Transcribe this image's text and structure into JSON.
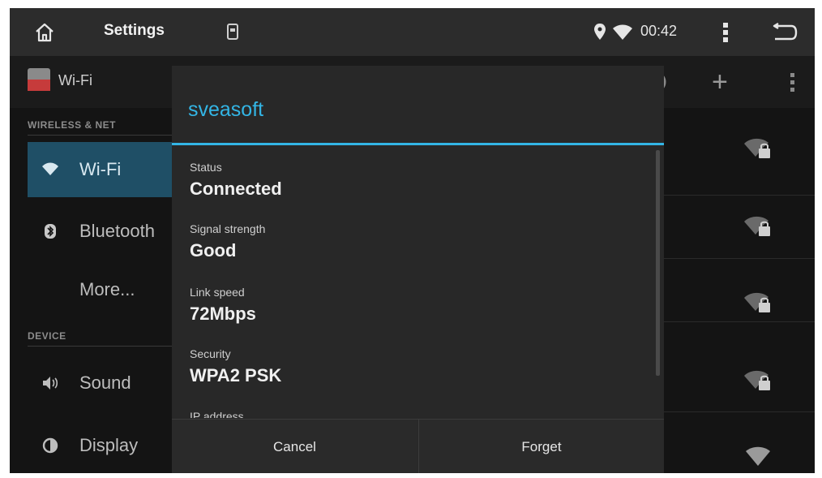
{
  "status_bar": {
    "title": "Settings",
    "time": "00:42",
    "icons": [
      "home-icon",
      "sd-card-icon",
      "location-icon",
      "wifi-icon",
      "overflow-menu-icon",
      "back-icon"
    ]
  },
  "action_bar": {
    "title": "Wi-Fi",
    "icons": [
      "settings-logo-icon",
      "add-icon",
      "overflow-menu-icon"
    ]
  },
  "sidebar": {
    "sections": [
      {
        "header": "WIRELESS & NET"
      },
      {
        "header": "DEVICE"
      }
    ],
    "items": [
      {
        "label": "Wi-Fi",
        "icon": "wifi-icon",
        "selected": true
      },
      {
        "label": "Bluetooth",
        "icon": "bluetooth-icon",
        "selected": false
      },
      {
        "label": "More...",
        "icon": "",
        "selected": false
      },
      {
        "label": "Sound",
        "icon": "speaker-icon",
        "selected": false
      },
      {
        "label": "Display",
        "icon": "brightness-icon",
        "selected": false
      }
    ]
  },
  "dialog": {
    "title": "sveasoft",
    "fields": [
      {
        "label": "Status",
        "value": "Connected"
      },
      {
        "label": "Signal strength",
        "value": "Good"
      },
      {
        "label": "Link speed",
        "value": "72Mbps"
      },
      {
        "label": "Security",
        "value": "WPA2 PSK"
      },
      {
        "label": "IP address",
        "value": ""
      }
    ],
    "buttons": {
      "cancel": "Cancel",
      "forget": "Forget"
    }
  },
  "colors": {
    "accent": "#33b5e5",
    "selected_row": "#1f4f66",
    "dialog_bg": "#282828",
    "status_bar_bg": "#2c2c2c"
  }
}
